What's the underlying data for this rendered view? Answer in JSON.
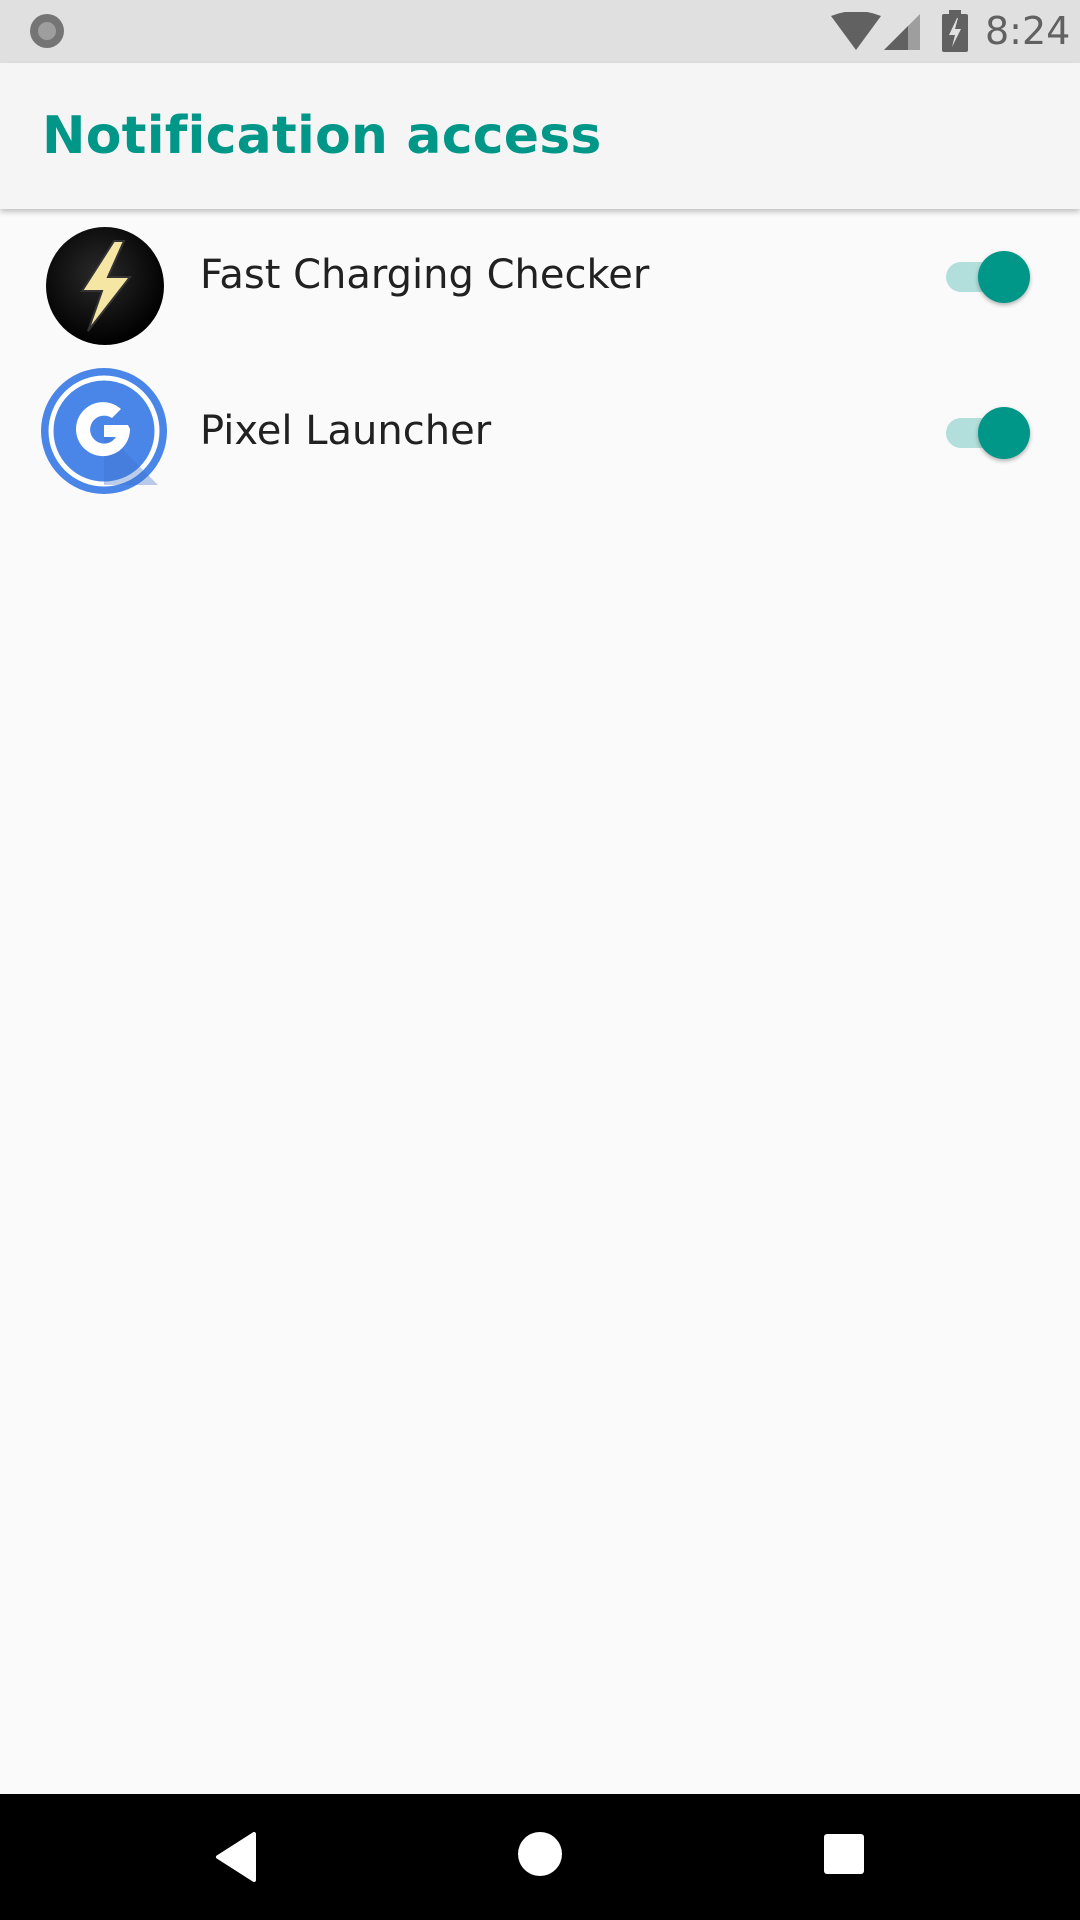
{
  "status_bar": {
    "time": "8:24",
    "icons": [
      "notification-dot-icon",
      "wifi-icon",
      "cell-signal-icon",
      "battery-charging-icon"
    ]
  },
  "app_bar": {
    "title": "Notification access",
    "title_color": "#009688"
  },
  "apps": [
    {
      "name": "Fast Charging Checker",
      "icon": "lightning-bolt-icon",
      "enabled": true
    },
    {
      "name": "Pixel Launcher",
      "icon": "google-g-icon",
      "enabled": true
    }
  ],
  "navigation": {
    "buttons": [
      "back-icon",
      "home-icon",
      "recents-icon"
    ]
  },
  "colors": {
    "accent": "#009688",
    "toggle_track": "#b2dfdb",
    "background": "#fafafa",
    "status_bar": "#e0e0e0"
  }
}
